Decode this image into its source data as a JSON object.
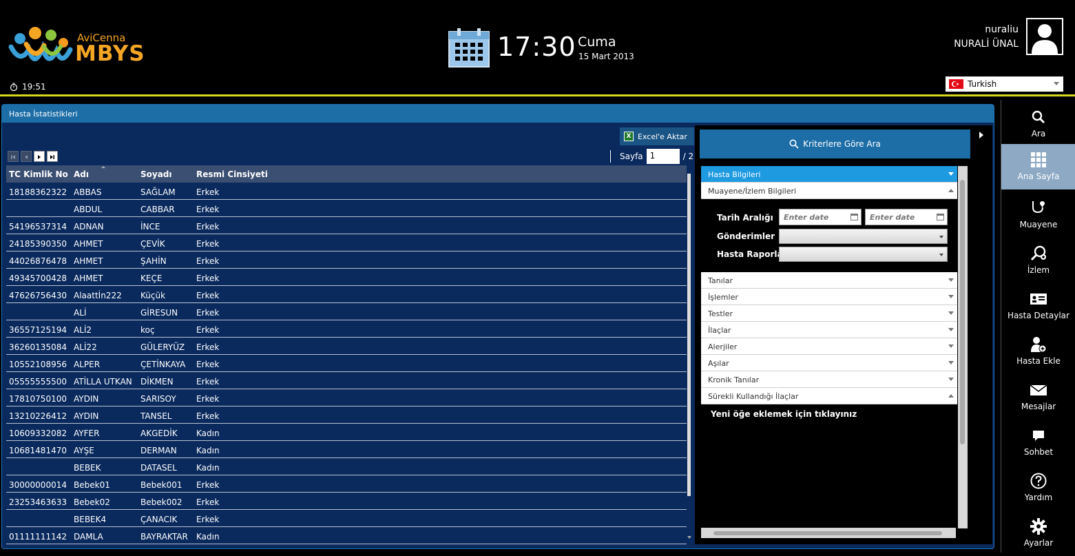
{
  "header": {
    "logo_line1": "AviCenna",
    "logo_line2": "MBYS",
    "small_time": "19:51",
    "big_time": "17:30",
    "day_name": "Cuma",
    "date": "15 Mart 2013",
    "username": "nuraliu",
    "fullname": "NURALİ ÜNAL",
    "language": "Turkish"
  },
  "panel": {
    "title": "Hasta İstatistikleri",
    "excel_label": "Excel'e Aktar",
    "page_label": "Sayfa",
    "page_value": "1",
    "page_total": "/ 2"
  },
  "grid": {
    "columns": [
      "TC Kimlik No",
      "Adı",
      "Soyadı",
      "Resmi Cinsiyeti"
    ],
    "rows": [
      [
        "18188362322",
        "ABBAS",
        "SAĞLAM",
        "Erkek"
      ],
      [
        "",
        "ABDUL",
        "CABBAR",
        "Erkek"
      ],
      [
        "54196537314",
        "ADNAN",
        "İNCE",
        "Erkek"
      ],
      [
        "24185390350",
        "AHMET",
        "ÇEVİK",
        "Erkek"
      ],
      [
        "44026876478",
        "AHMET",
        "ŞAHİN",
        "Erkek"
      ],
      [
        "49345700428",
        "AHMET",
        "KEÇE",
        "Erkek"
      ],
      [
        "47626756430",
        "Alaattİn222",
        "Küçük",
        "Erkek"
      ],
      [
        "",
        "ALİ",
        "GİRESUN",
        "Erkek"
      ],
      [
        "36557125194",
        "ALİ2",
        "koç",
        "Erkek"
      ],
      [
        "36260135084",
        "ALİ22",
        "GÜLERYÜZ",
        "Erkek"
      ],
      [
        "10552108956",
        "ALPER",
        "ÇETİNKAYA",
        "Erkek"
      ],
      [
        "05555555500",
        "ATİLLA UTKAN",
        "DİKMEN",
        "Erkek"
      ],
      [
        "17810750100",
        "AYDIN",
        "SARISOY",
        "Erkek"
      ],
      [
        "13210226412",
        "AYDIN",
        "TANSEL",
        "Erkek"
      ],
      [
        "10609332082",
        "AYFER",
        "AKGEDİK",
        "Kadın"
      ],
      [
        "10681481470",
        "AYŞE",
        "DERMAN",
        "Kadın"
      ],
      [
        "",
        "BEBEK",
        "DATASEL",
        "Kadın"
      ],
      [
        "30000000014",
        "Bebek01",
        "Bebek001",
        "Erkek"
      ],
      [
        "23253463633",
        "Bebek02",
        "Bebek002",
        "Erkek"
      ],
      [
        "",
        "BEBEK4",
        "ÇANACIK",
        "Erkek"
      ],
      [
        "01111111142",
        "DAMLA",
        "BAYRAKTAR",
        "Kadın"
      ]
    ]
  },
  "search": {
    "button_label": "Kriterlere Göre Ara",
    "sections": {
      "s0": "Hasta Bilgileri",
      "s1": "Muayene/İzlem Bilgileri",
      "s2": "Tanılar",
      "s3": "İşlemler",
      "s4": "Testler",
      "s5": "İlaçlar",
      "s6": "Alerjiler",
      "s7": "Aşılar",
      "s8": "Kronik Tanılar",
      "s9": "Sürekli Kullandığı İlaçlar"
    },
    "fields": {
      "date_range": "Tarih Aralığı",
      "referrals": "Gönderimler",
      "reports": "Hasta Raporları",
      "date_placeholder": "Enter date"
    },
    "new_item": "Yeni öğe eklemek için tıklayınız"
  },
  "sidebar": {
    "ara": "Ara",
    "ana_sayfa": "Ana Sayfa",
    "muayene": "Muayene",
    "izlem": "İzlem",
    "hasta_detaylar": "Hasta Detaylar",
    "hasta_ekle": "Hasta Ekle",
    "mesajlar": "Mesajlar",
    "sohbet": "Sohbet",
    "yardim": "Yardım",
    "ayarlar": "Ayarlar"
  },
  "colors": {
    "accent_yellow": "#d6d820",
    "panel_blue": "#0a2a5e",
    "header_blue": "#1d6ea7",
    "selected_section": "#1e9ae0",
    "sidebar_active": "#8da9c4"
  }
}
